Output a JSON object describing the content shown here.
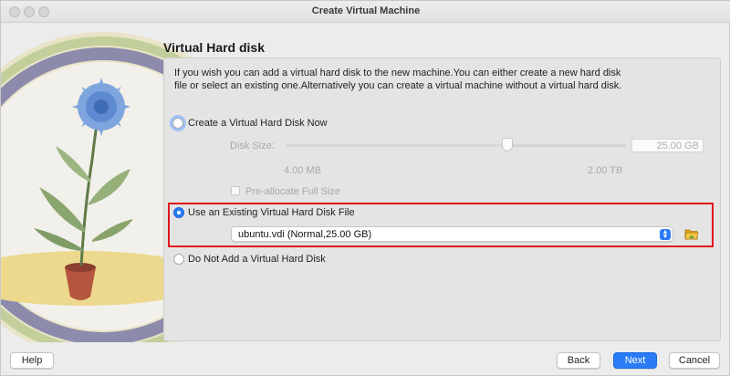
{
  "window": {
    "title": "Create Virtual Machine"
  },
  "page": {
    "heading": "Virtual Hard disk",
    "description": "If you wish you can add a virtual hard disk to the new machine.You can either create a new hard disk file or select an existing one.Alternatively you can create a virtual machine without a virtual hard disk."
  },
  "options": {
    "create_new": {
      "label": "Create a Virtual Hard Disk Now",
      "selected": false
    },
    "use_existing": {
      "label": "Use an Existing Virtual Hard Disk File",
      "selected": true
    },
    "no_disk": {
      "label": "Do Not Add a Virtual Hard Disk",
      "selected": false
    }
  },
  "disk_size": {
    "label": "Disk Size:",
    "value": "25.00 GB",
    "min_label": "4.00 MB",
    "max_label": "2.00 TB",
    "slider_fraction": 0.65
  },
  "preallocate": {
    "label": "Pre-allocate Full Size",
    "checked": false
  },
  "existing_file": {
    "selected": "ubuntu.vdi (Normal,25.00 GB)"
  },
  "icons": {
    "folder": "folder-open-icon",
    "select_arrows": "chevron-up-down-icon"
  },
  "buttons": {
    "help": "Help",
    "back": "Back",
    "next": "Next",
    "cancel": "Cancel"
  },
  "colors": {
    "accent": "#2a7cf6",
    "highlight": "#e0141a"
  }
}
